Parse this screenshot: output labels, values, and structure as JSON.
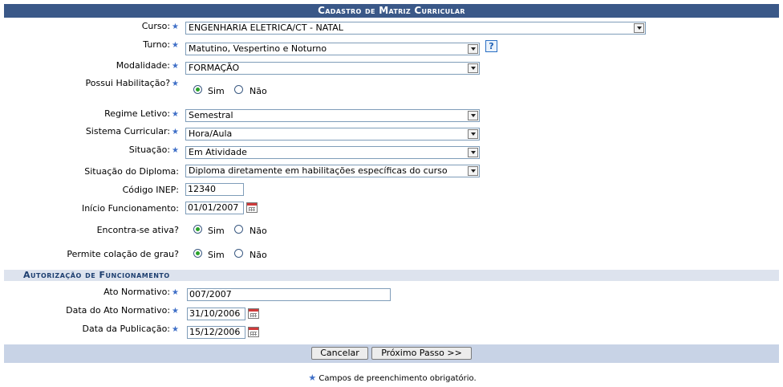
{
  "header": {
    "title": "Cadastro de Matriz Curricular"
  },
  "form": {
    "curso": {
      "label": "Curso:",
      "value": "ENGENHARIA ELETRICA/CT - NATAL"
    },
    "turno": {
      "label": "Turno:",
      "value": "Matutino, Vespertino e Noturno",
      "help": "?"
    },
    "modalidade": {
      "label": "Modalidade:",
      "value": "FORMAÇÃO"
    },
    "habilitacao": {
      "label": "Possui Habilitação?",
      "option_yes": "Sim",
      "option_no": "Não",
      "selected": "Sim"
    },
    "regime": {
      "label": "Regime Letivo:",
      "value": "Semestral"
    },
    "sistema": {
      "label": "Sistema Curricular:",
      "value": "Hora/Aula"
    },
    "situacao": {
      "label": "Situação:",
      "value": "Em Atividade"
    },
    "situacao_diploma": {
      "label": "Situação do Diploma:",
      "value": "Diploma diretamente em habilitações específicas do curso"
    },
    "codigo_inep": {
      "label": "Código INEP:",
      "value": "12340"
    },
    "inicio": {
      "label": "Início Funcionamento:",
      "value": "01/01/2007"
    },
    "ativa": {
      "label": "Encontra-se ativa?",
      "option_yes": "Sim",
      "option_no": "Não",
      "selected": "Sim"
    },
    "colacao": {
      "label": "Permite colação de grau?",
      "option_yes": "Sim",
      "option_no": "Não",
      "selected": "Sim"
    }
  },
  "autorizacao": {
    "title": "Autorização de Funcionamento",
    "ato": {
      "label": "Ato Normativo:",
      "value": "007/2007"
    },
    "data_ato": {
      "label": "Data do Ato Normativo:",
      "value": "31/10/2006"
    },
    "data_pub": {
      "label": "Data da Publicação:",
      "value": "15/12/2006"
    }
  },
  "buttons": {
    "cancel": "Cancelar",
    "next": "Próximo Passo >>"
  },
  "footer_note": "Campos de preenchimento obrigatório.",
  "required_mark": "★",
  "colors": {
    "header_bg": "#3a5888",
    "subheader_bg": "#dde3ee",
    "footer_bg": "#c8d3e6",
    "required": "#3f6fc7"
  }
}
